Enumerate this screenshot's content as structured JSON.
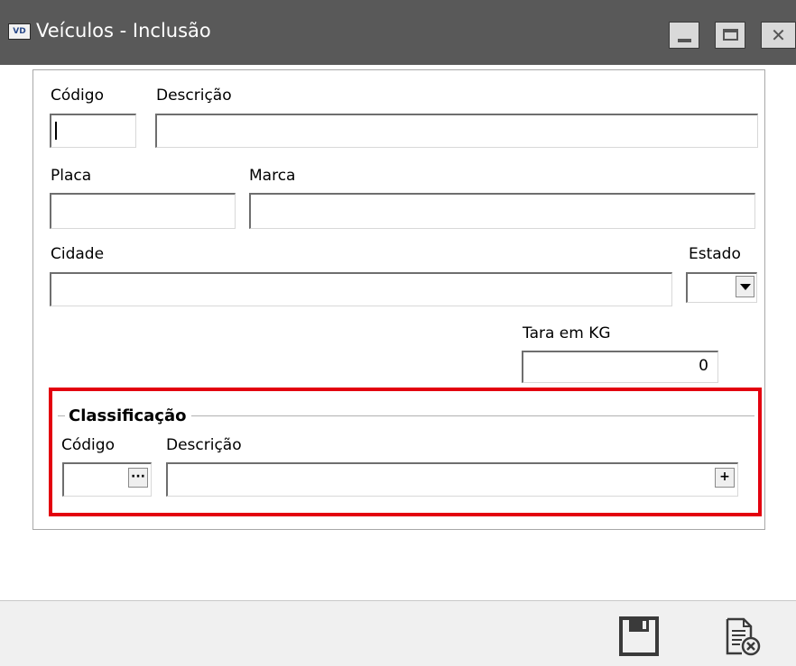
{
  "window": {
    "icon_text": "VD",
    "title": "Veículos - Inclusão",
    "controls": {
      "minimize": "minimize-icon",
      "maximize": "maximize-icon",
      "close": "close-icon"
    }
  },
  "form": {
    "codigo_label": "Código",
    "descricao_label": "Descrição",
    "placa_label": "Placa",
    "marca_label": "Marca",
    "cidade_label": "Cidade",
    "estado_label": "Estado",
    "tara_label": "Tara em KG",
    "tara_value": "0"
  },
  "classificacao": {
    "title": "Classificação",
    "codigo_label": "Código",
    "descricao_label": "Descrição",
    "lookup_button": "···",
    "add_button": "+"
  },
  "footer": {
    "save_icon": "save-icon",
    "cancel_icon": "cancel-document-icon"
  },
  "colors": {
    "titlebar": "#595959",
    "highlight": "#e3000f",
    "footer": "#f0f0f0"
  }
}
